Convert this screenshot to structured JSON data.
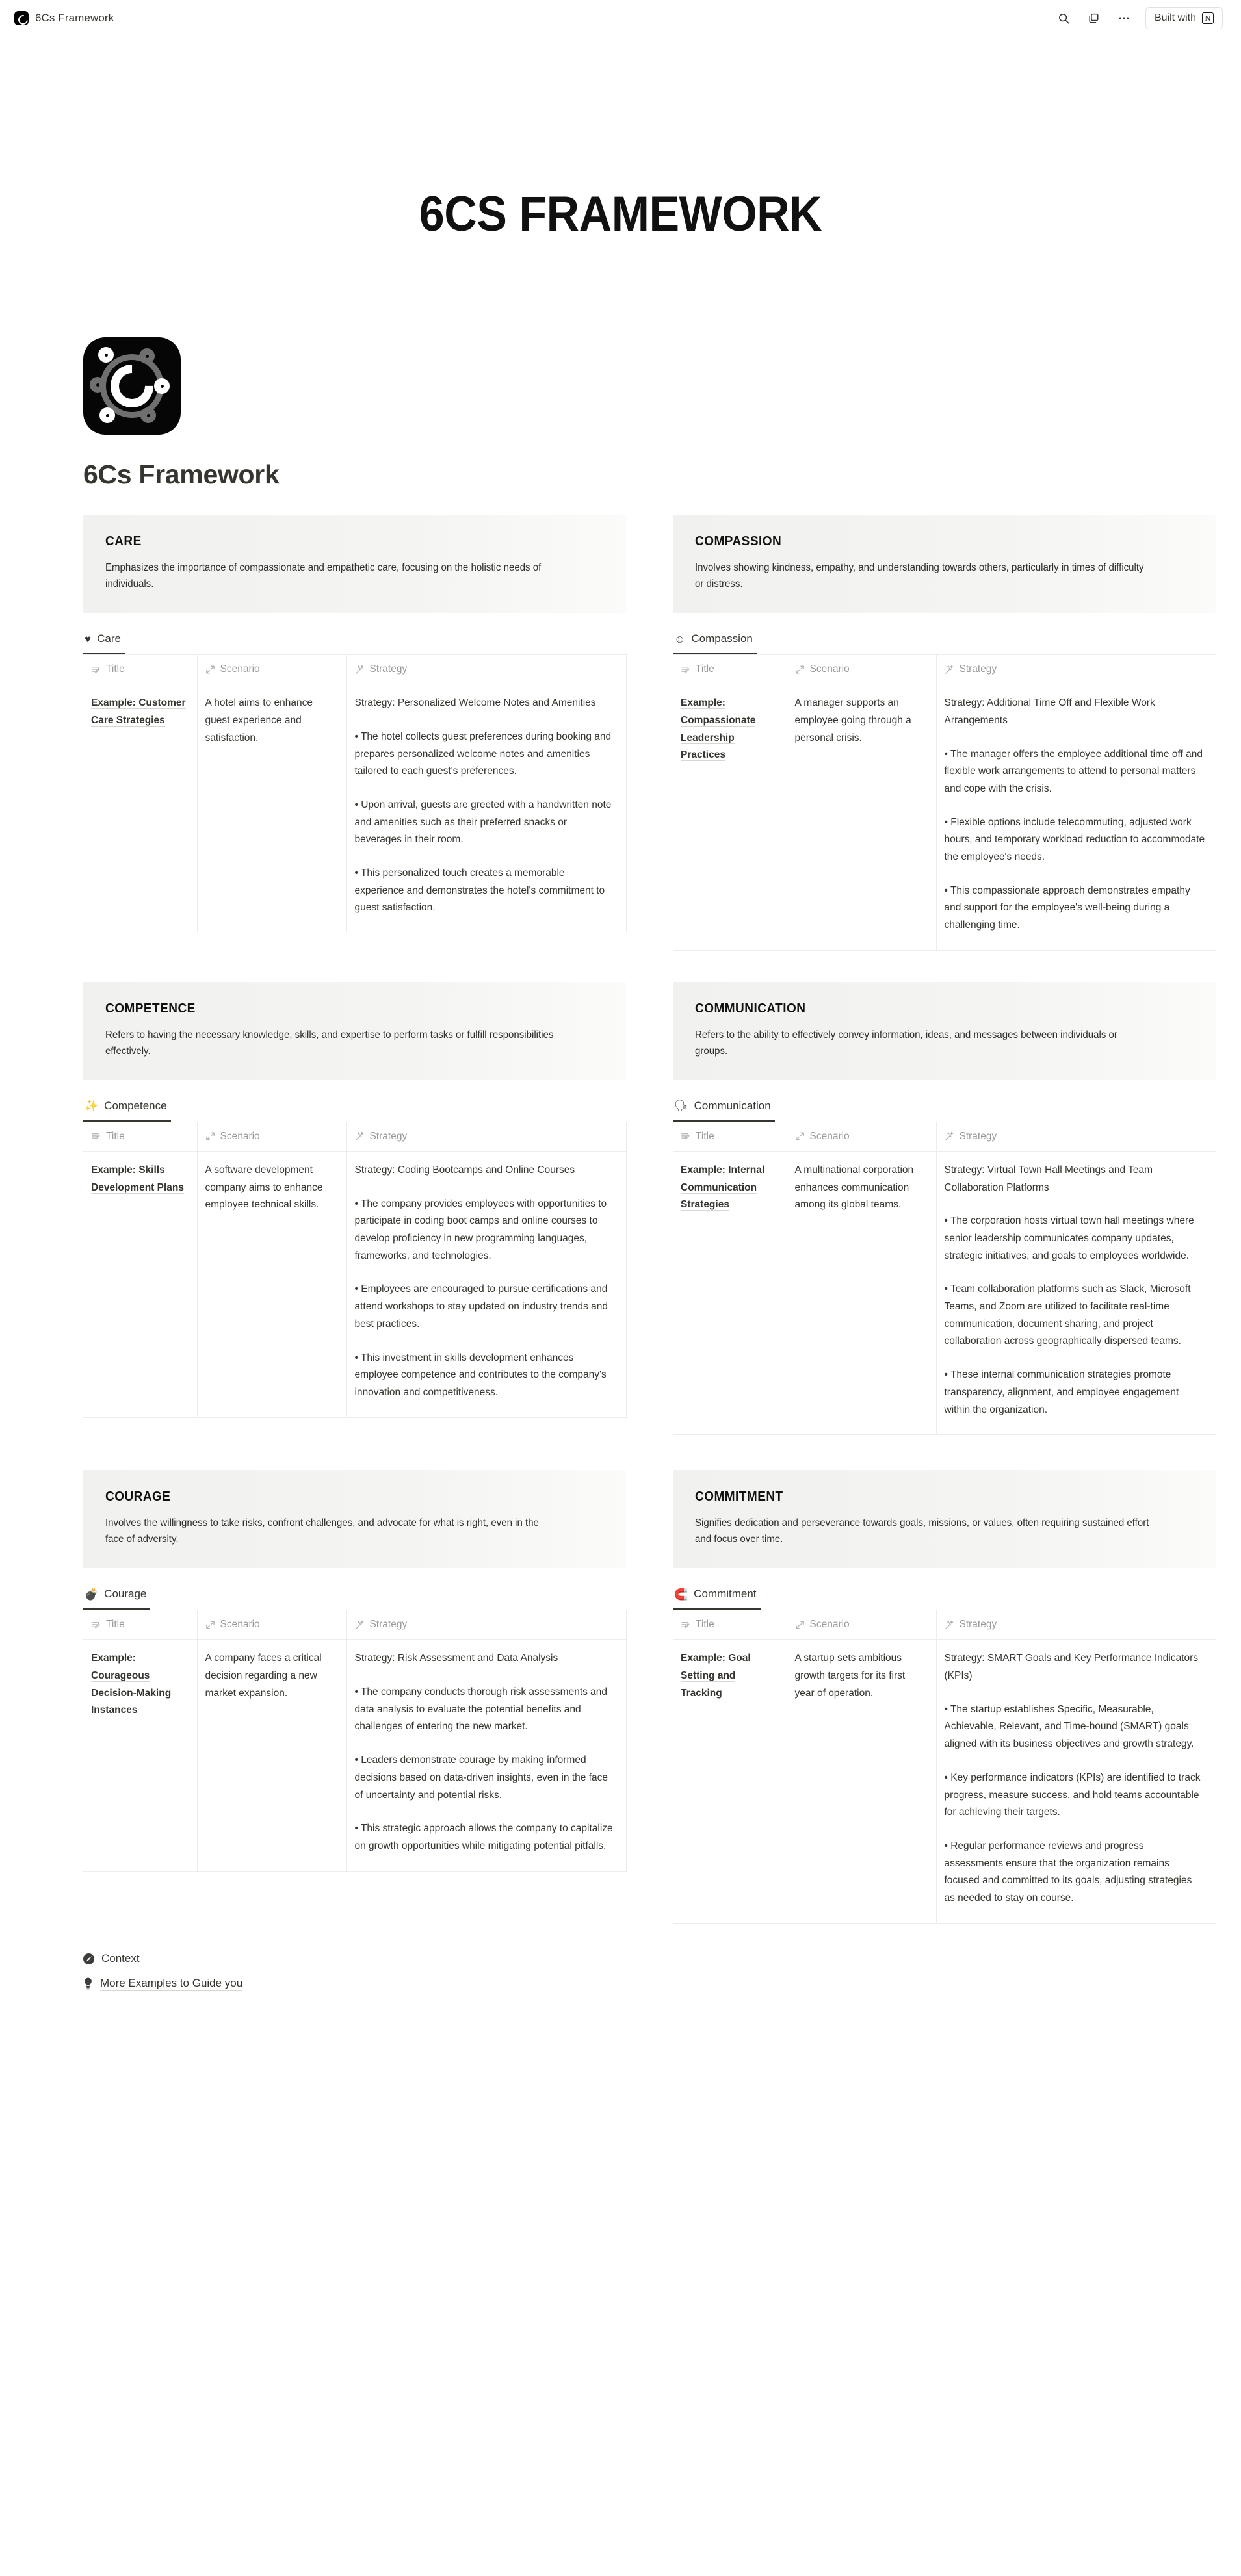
{
  "topbar": {
    "title": "6Cs Framework",
    "search_icon": "search-icon",
    "duplicate_icon": "duplicate-icon",
    "more_icon": "more-options-icon",
    "built_with_label": "Built with",
    "built_with_glyph": "N"
  },
  "hero": {
    "heading": "6CS FRAMEWORK"
  },
  "page": {
    "icon_name": "6cs-app-icon",
    "title": "6Cs Framework"
  },
  "columns": {
    "title": "Title",
    "scenario": "Scenario",
    "strategy": "Strategy",
    "title_icon": "text-property-icon",
    "scenario_icon": "expand-property-icon",
    "strategy_icon": "sparkle-property-icon"
  },
  "sections": [
    {
      "key": "care",
      "banner_heading": "CARE",
      "banner_text": "Emphasizes the importance of compassionate and empathetic care, focusing on the holistic needs of individuals.",
      "db_emoji": "♥",
      "db_name": "Care",
      "db_icon": "heart-icon",
      "row": {
        "title": "Example: Customer Care Strategies",
        "scenario": "A hotel aims to enhance guest experience and satisfaction.",
        "strategy_heading": "Strategy: Personalized Welcome Notes and Amenities",
        "strategy_bullets": [
          "• The hotel collects guest preferences during booking and prepares personalized welcome notes and amenities tailored to each guest's preferences.",
          "• Upon arrival, guests are greeted with a handwritten note and amenities such as their preferred snacks or beverages in their room.",
          "• This personalized touch creates a memorable experience and demonstrates the hotel's commitment to guest satisfaction."
        ]
      }
    },
    {
      "key": "compassion",
      "banner_heading": "COMPASSION",
      "banner_text": "Involves showing kindness, empathy, and understanding towards others, particularly in times of difficulty or distress.",
      "db_emoji": "☺",
      "db_name": "Compassion",
      "db_icon": "smiley-face-icon",
      "row": {
        "title": "Example: Compassionate Leadership Practices",
        "scenario": "A manager supports an employee going through a personal crisis.",
        "strategy_heading": "Strategy: Additional Time Off and Flexible Work Arrangements",
        "strategy_bullets": [
          "• The manager offers the employee additional time off and flexible work arrangements to attend to personal matters and cope with the crisis.",
          "• Flexible options include telecommuting, adjusted work hours, and temporary workload reduction to accommodate the employee's needs.",
          "• This compassionate approach demonstrates empathy and support for the employee's well-being during a challenging time."
        ]
      }
    },
    {
      "key": "competence",
      "banner_heading": "COMPETENCE",
      "banner_text": "Refers to having the necessary knowledge, skills, and expertise to perform tasks or fulfill responsibilities effectively.",
      "db_emoji": "✨",
      "db_name": "Competence",
      "db_icon": "sparkles-icon",
      "row": {
        "title": "Example: Skills Development Plans",
        "scenario": "A software development company aims to enhance employee technical skills.",
        "strategy_heading": "Strategy: Coding Bootcamps and Online Courses",
        "strategy_bullets": [
          "• The company provides employees with opportunities to participate in coding boot camps and online courses to develop proficiency in new programming languages, frameworks, and technologies.",
          "• Employees are encouraged to pursue certifications and attend workshops to stay updated on industry trends and best practices.",
          "• This investment in skills development enhances employee competence and contributes to the company's innovation and competitiveness."
        ]
      }
    },
    {
      "key": "communication",
      "banner_heading": "COMMUNICATION",
      "banner_text": "Refers to the ability to effectively convey information, ideas, and messages between individuals or groups.",
      "db_emoji": "🗣",
      "db_name": "Communication",
      "db_icon": "speaking-head-icon",
      "row": {
        "title": "Example: Internal Communication Strategies",
        "scenario": "A multinational corporation enhances communication among its global teams.",
        "strategy_heading": "Strategy: Virtual Town Hall Meetings and Team Collaboration Platforms",
        "strategy_bullets": [
          "• The corporation hosts virtual town hall meetings where senior leadership communicates company updates, strategic initiatives, and goals to employees worldwide.",
          "• Team collaboration platforms such as Slack, Microsoft Teams, and Zoom are utilized to facilitate real-time communication, document sharing, and project collaboration across geographically dispersed teams.",
          "• These internal communication strategies promote transparency, alignment, and employee engagement within the organization."
        ]
      }
    },
    {
      "key": "courage",
      "banner_heading": "COURAGE",
      "banner_text": "Involves the willingness to take risks, confront challenges, and advocate for what is right, even in the face of adversity.",
      "db_emoji": "💣",
      "db_name": "Courage",
      "db_icon": "bomb-icon",
      "row": {
        "title": "Example: Courageous Decision-Making Instances",
        "scenario": "A company faces a critical decision regarding a new market expansion.",
        "strategy_heading": "Strategy: Risk Assessment and Data Analysis",
        "strategy_bullets": [
          "• The company conducts thorough risk assessments and data analysis to evaluate the potential benefits and challenges of entering the new market.",
          "• Leaders demonstrate courage by making informed decisions based on data-driven insights, even in the face of uncertainty and potential risks.",
          "• This strategic approach allows the company to capitalize on growth opportunities while mitigating potential pitfalls."
        ]
      }
    },
    {
      "key": "commitment",
      "banner_heading": "COMMITMENT",
      "banner_text": "Signifies dedication and perseverance towards goals, missions, or values, often requiring sustained effort and focus over time.",
      "db_emoji": "🧲",
      "db_name": "Commitment",
      "db_icon": "magnet-icon",
      "row": {
        "title": "Example: Goal Setting and Tracking",
        "scenario": "A startup sets ambitious growth targets for its first year of operation.",
        "strategy_heading": "Strategy: SMART Goals and Key Performance Indicators (KPIs)",
        "strategy_bullets": [
          "• The startup establishes Specific, Measurable, Achievable, Relevant, and Time-bound (SMART) goals aligned with its business objectives and growth strategy.",
          "• Key performance indicators (KPIs) are identified to track progress, measure success, and hold teams accountable for achieving their targets.",
          "• Regular performance reviews and progress assessments ensure that the organization remains focused and committed to its goals, adjusting strategies as needed to stay on course."
        ]
      }
    }
  ],
  "footer_links": [
    {
      "label": "Context",
      "icon": "compass-icon"
    },
    {
      "label": "More Examples to Guide you",
      "icon": "lightbulb-icon"
    }
  ]
}
